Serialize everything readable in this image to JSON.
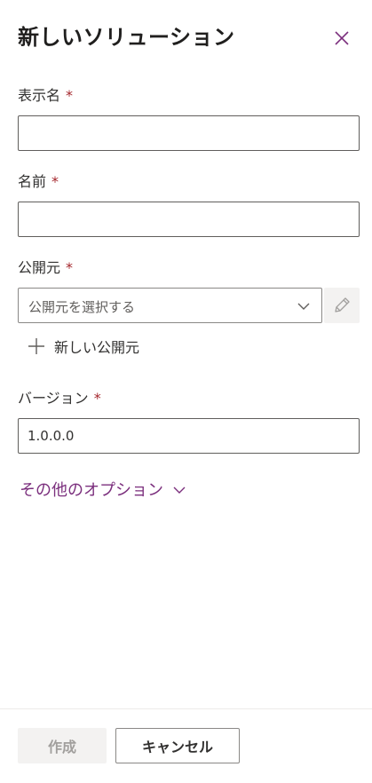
{
  "panel": {
    "title": "新しいソリューション"
  },
  "fields": {
    "display_name": {
      "label": "表示名",
      "required": "*",
      "value": ""
    },
    "name": {
      "label": "名前",
      "required": "*",
      "value": ""
    },
    "publisher": {
      "label": "公開元",
      "required": "*",
      "placeholder": "公開元を選択する",
      "new_publisher_label": "新しい公開元"
    },
    "version": {
      "label": "バージョン",
      "required": "*",
      "value": "1.0.0.0"
    }
  },
  "more_options": {
    "label": "その他のオプション"
  },
  "footer": {
    "create_label": "作成",
    "cancel_label": "キャンセル"
  },
  "icons": {
    "close": "close-icon",
    "dropdown": "chevron-down-icon",
    "edit": "pencil-icon",
    "add": "plus-icon",
    "expand": "chevron-down-icon"
  },
  "colors": {
    "accent": "#7b2f7d",
    "required": "#a4262c",
    "disabled_bg": "#f3f2f1",
    "disabled_text": "#a19f9d"
  }
}
